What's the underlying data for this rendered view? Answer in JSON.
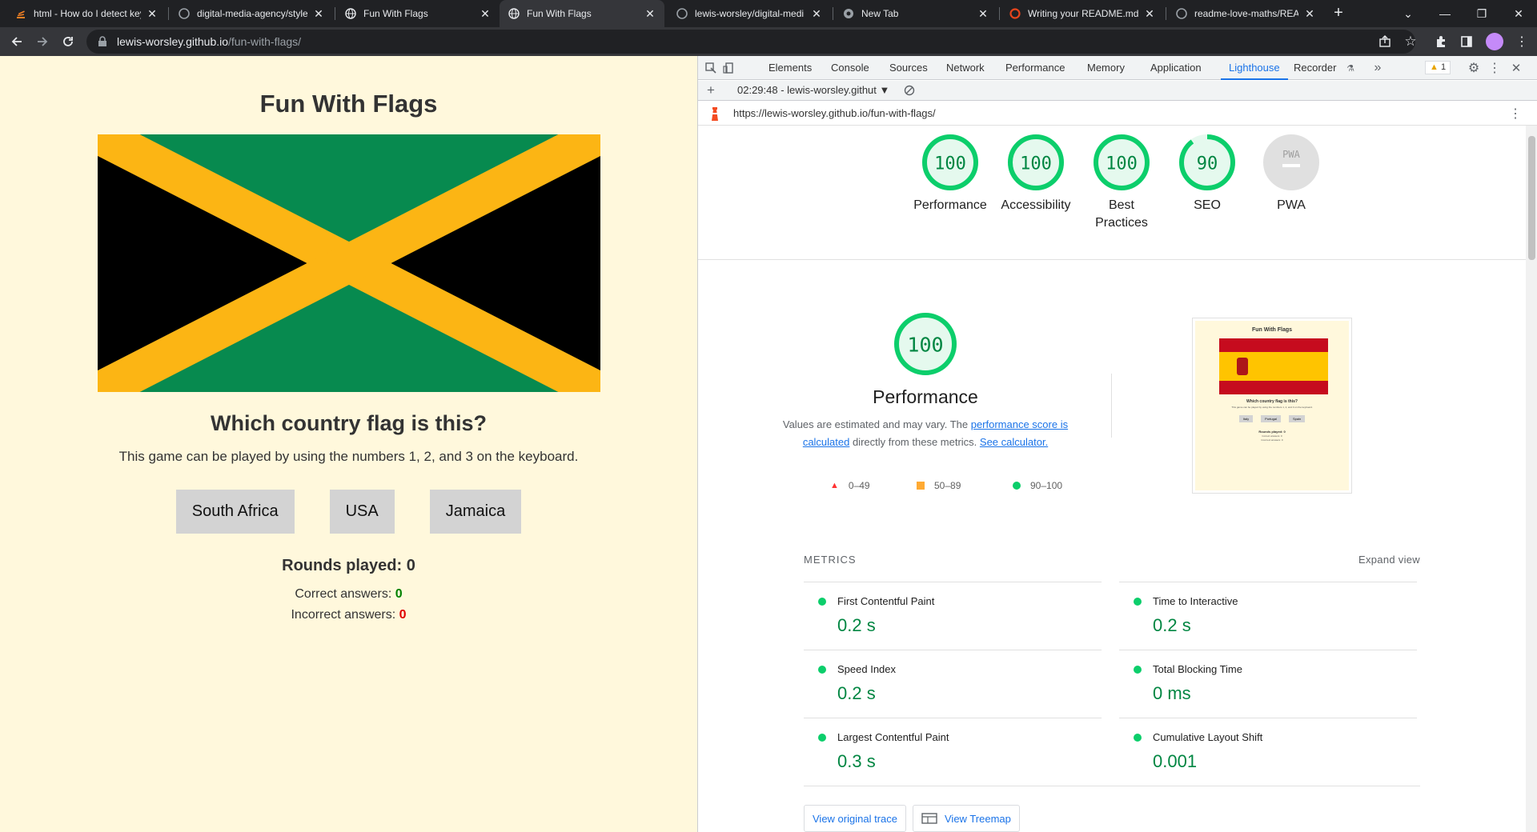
{
  "browser": {
    "tabs": [
      {
        "title": "html - How do I detect key",
        "favicon": "stackoverflow-icon",
        "active": false
      },
      {
        "title": "digital-media-agency/style",
        "favicon": "github-icon",
        "active": false
      },
      {
        "title": "Fun With Flags",
        "favicon": "globe-icon",
        "active": false
      },
      {
        "title": "Fun With Flags",
        "favicon": "globe-icon",
        "active": true
      },
      {
        "title": "lewis-worsley/digital-medi",
        "favicon": "github-icon",
        "active": false
      },
      {
        "title": "New Tab",
        "favicon": "chrome-icon",
        "active": false
      },
      {
        "title": "Writing your README.md",
        "favicon": "codeinstitute-icon",
        "active": false
      },
      {
        "title": "readme-love-maths/READ",
        "favicon": "github-icon",
        "active": false
      }
    ],
    "address": {
      "host": "lewis-worsley.github.io",
      "path": "/fun-with-flags/"
    }
  },
  "page": {
    "title": "Fun With Flags",
    "flag": {
      "country": "Jamaica",
      "colors": {
        "green": "#078a4f",
        "gold": "#fcb514",
        "black": "#000000"
      }
    },
    "question": "Which country flag is this?",
    "instructions": "This game can be played by using the numbers 1, 2, and 3 on the keyboard.",
    "answers": [
      "South Africa",
      "USA",
      "Jamaica"
    ],
    "rounds_label": "Rounds played: ",
    "rounds_value": "0",
    "correct_label": "Correct answers: ",
    "correct_value": "0",
    "incorrect_label": "Incorrect answers: ",
    "incorrect_value": "0",
    "colors": {
      "background": "#fff8dc",
      "correct": "#008000",
      "incorrect": "#e00000"
    }
  },
  "devtools": {
    "tabs": [
      "Elements",
      "Console",
      "Sources",
      "Network",
      "Performance",
      "Memory",
      "Application",
      "Lighthouse",
      "Recorder"
    ],
    "active_tab": "Lighthouse",
    "warning_count": "1",
    "report_select": "02:29:48 - lewis-worsley.githut",
    "audited_url": "https://lewis-worsley.github.io/fun-with-flags/",
    "gauges": [
      {
        "label": "Performance",
        "score": "100",
        "value": 1.0
      },
      {
        "label": "Accessibility",
        "score": "100",
        "value": 1.0
      },
      {
        "label": "Best Practices",
        "score": "100",
        "value": 1.0
      },
      {
        "label": "SEO",
        "score": "90",
        "value": 0.9
      },
      {
        "label": "PWA",
        "score": "PWA",
        "value": 0
      }
    ],
    "perf": {
      "score": "100",
      "title": "Performance",
      "desc_1": "Values are estimated and may vary. The ",
      "desc_link_1": "performance score is calculated",
      "desc_2": " directly from these metrics. ",
      "desc_link_2": "See calculator."
    },
    "legend": [
      {
        "range": "0–49",
        "shape": "triangle",
        "color": "#ff3333"
      },
      {
        "range": "50–89",
        "shape": "square",
        "color": "#ffaa33"
      },
      {
        "range": "90–100",
        "shape": "circle",
        "color": "#0cce6b"
      }
    ],
    "thumbnail": {
      "title": "Fun With Flags",
      "question": "Which country flag is this?",
      "instructions": "This game can be played by using the numbers 1, 2, and 3 on the keyboard.",
      "answers": [
        "Italy",
        "Portugal",
        "Spain"
      ],
      "rounds": "Rounds played: 0",
      "correct": "Correct answers: 0",
      "incorrect": "Incorrect answers: 0"
    },
    "metrics_header": "METRICS",
    "expand_view": "Expand view",
    "metrics": [
      {
        "name": "First Contentful Paint",
        "value": "0.2 s"
      },
      {
        "name": "Time to Interactive",
        "value": "0.2 s"
      },
      {
        "name": "Speed Index",
        "value": "0.2 s"
      },
      {
        "name": "Total Blocking Time",
        "value": "0 ms"
      },
      {
        "name": "Largest Contentful Paint",
        "value": "0.3 s"
      },
      {
        "name": "Cumulative Layout Shift",
        "value": "0.001"
      }
    ],
    "buttons": {
      "original_trace": "View original trace",
      "treemap": "View Treemap"
    },
    "colors": {
      "pass": "#0cce6b",
      "pass_text": "#018642",
      "accent": "#1a73e8"
    }
  }
}
